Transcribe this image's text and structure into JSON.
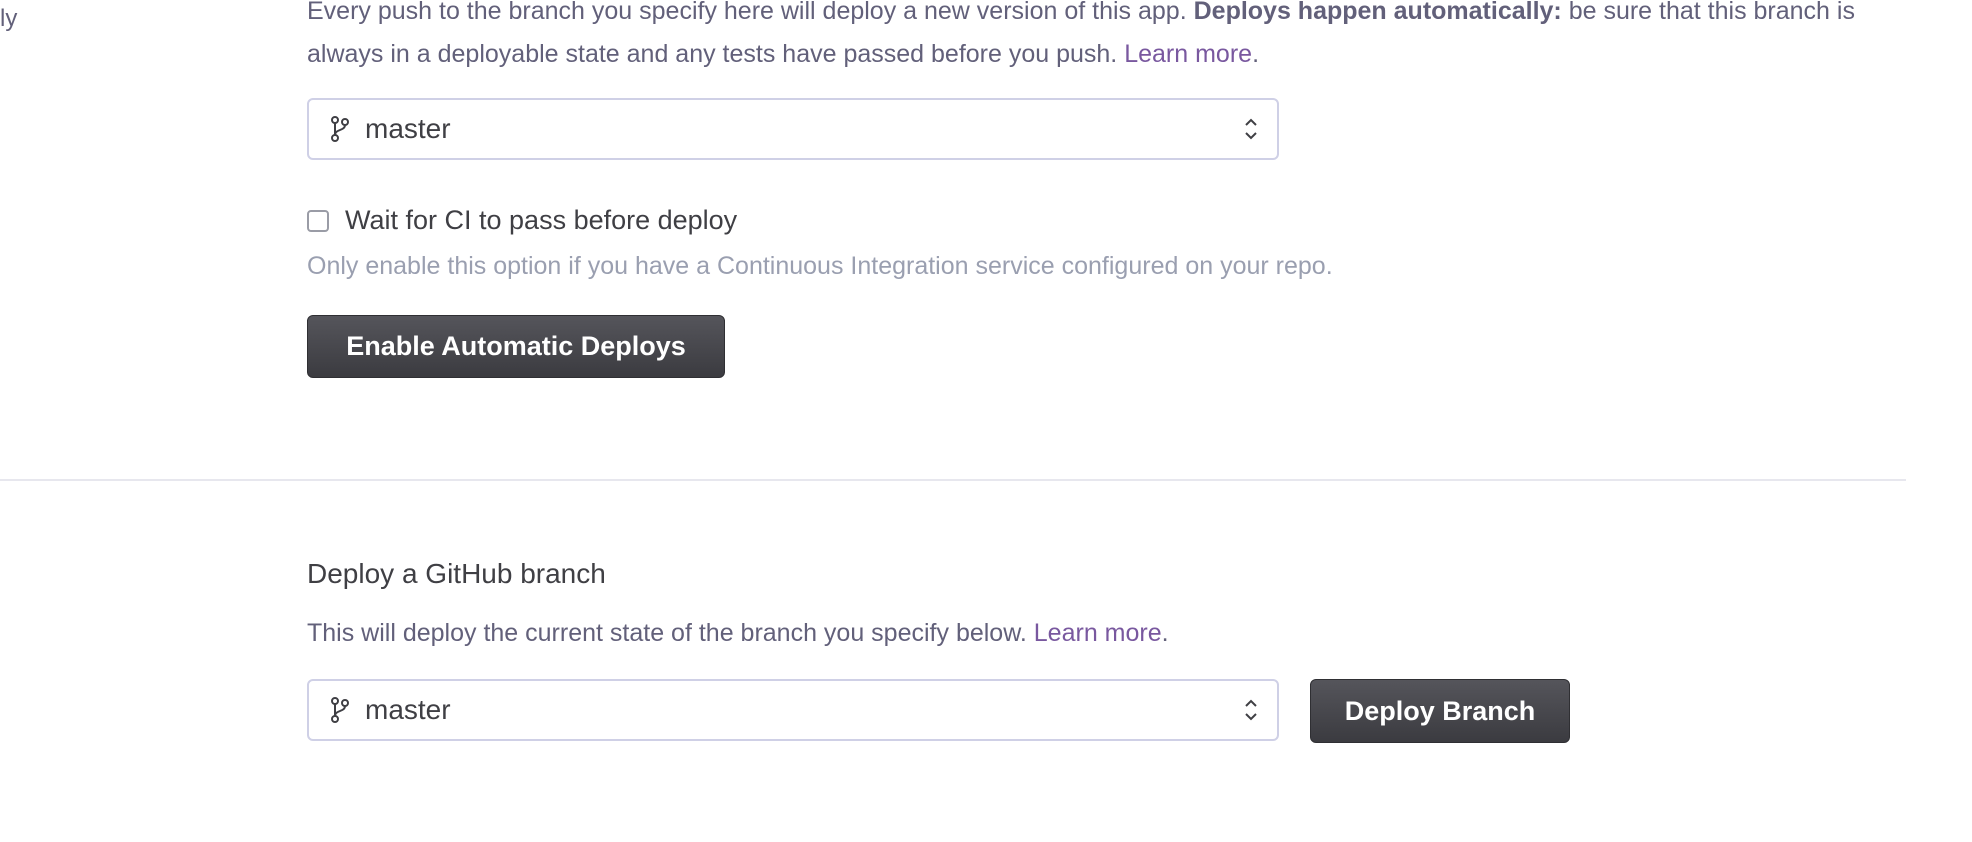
{
  "sidebar_fragment": "ly",
  "auto_deploy": {
    "description_prefix": "Every push to the branch you specify here will deploy a new version of this app. ",
    "description_bold": "Deploys happen automatically:",
    "description_suffix": " be sure that this branch is always in a deployable state and any tests have passed before you push.",
    "learn_more": "Learn more",
    "branch_select_value": "master",
    "ci_checkbox_label": "Wait for CI to pass before deploy",
    "ci_checkbox_checked": false,
    "ci_help": "Only enable this option if you have a Continuous Integration service configured on your repo.",
    "enable_button": "Enable Automatic Deploys"
  },
  "manual_deploy": {
    "heading": "Deploy a GitHub branch",
    "description": "This will deploy the current state of the branch you specify below.",
    "learn_more": "Learn more",
    "branch_select_value": "master",
    "deploy_button": "Deploy Branch"
  },
  "icons": {
    "branch": "git-branch-icon",
    "select_arrows": "chevron-up-down-icon"
  },
  "colors": {
    "link": "#79589f",
    "button_bg": "#47474c",
    "muted_text": "#9a9fb0",
    "body_text": "#62607a"
  }
}
